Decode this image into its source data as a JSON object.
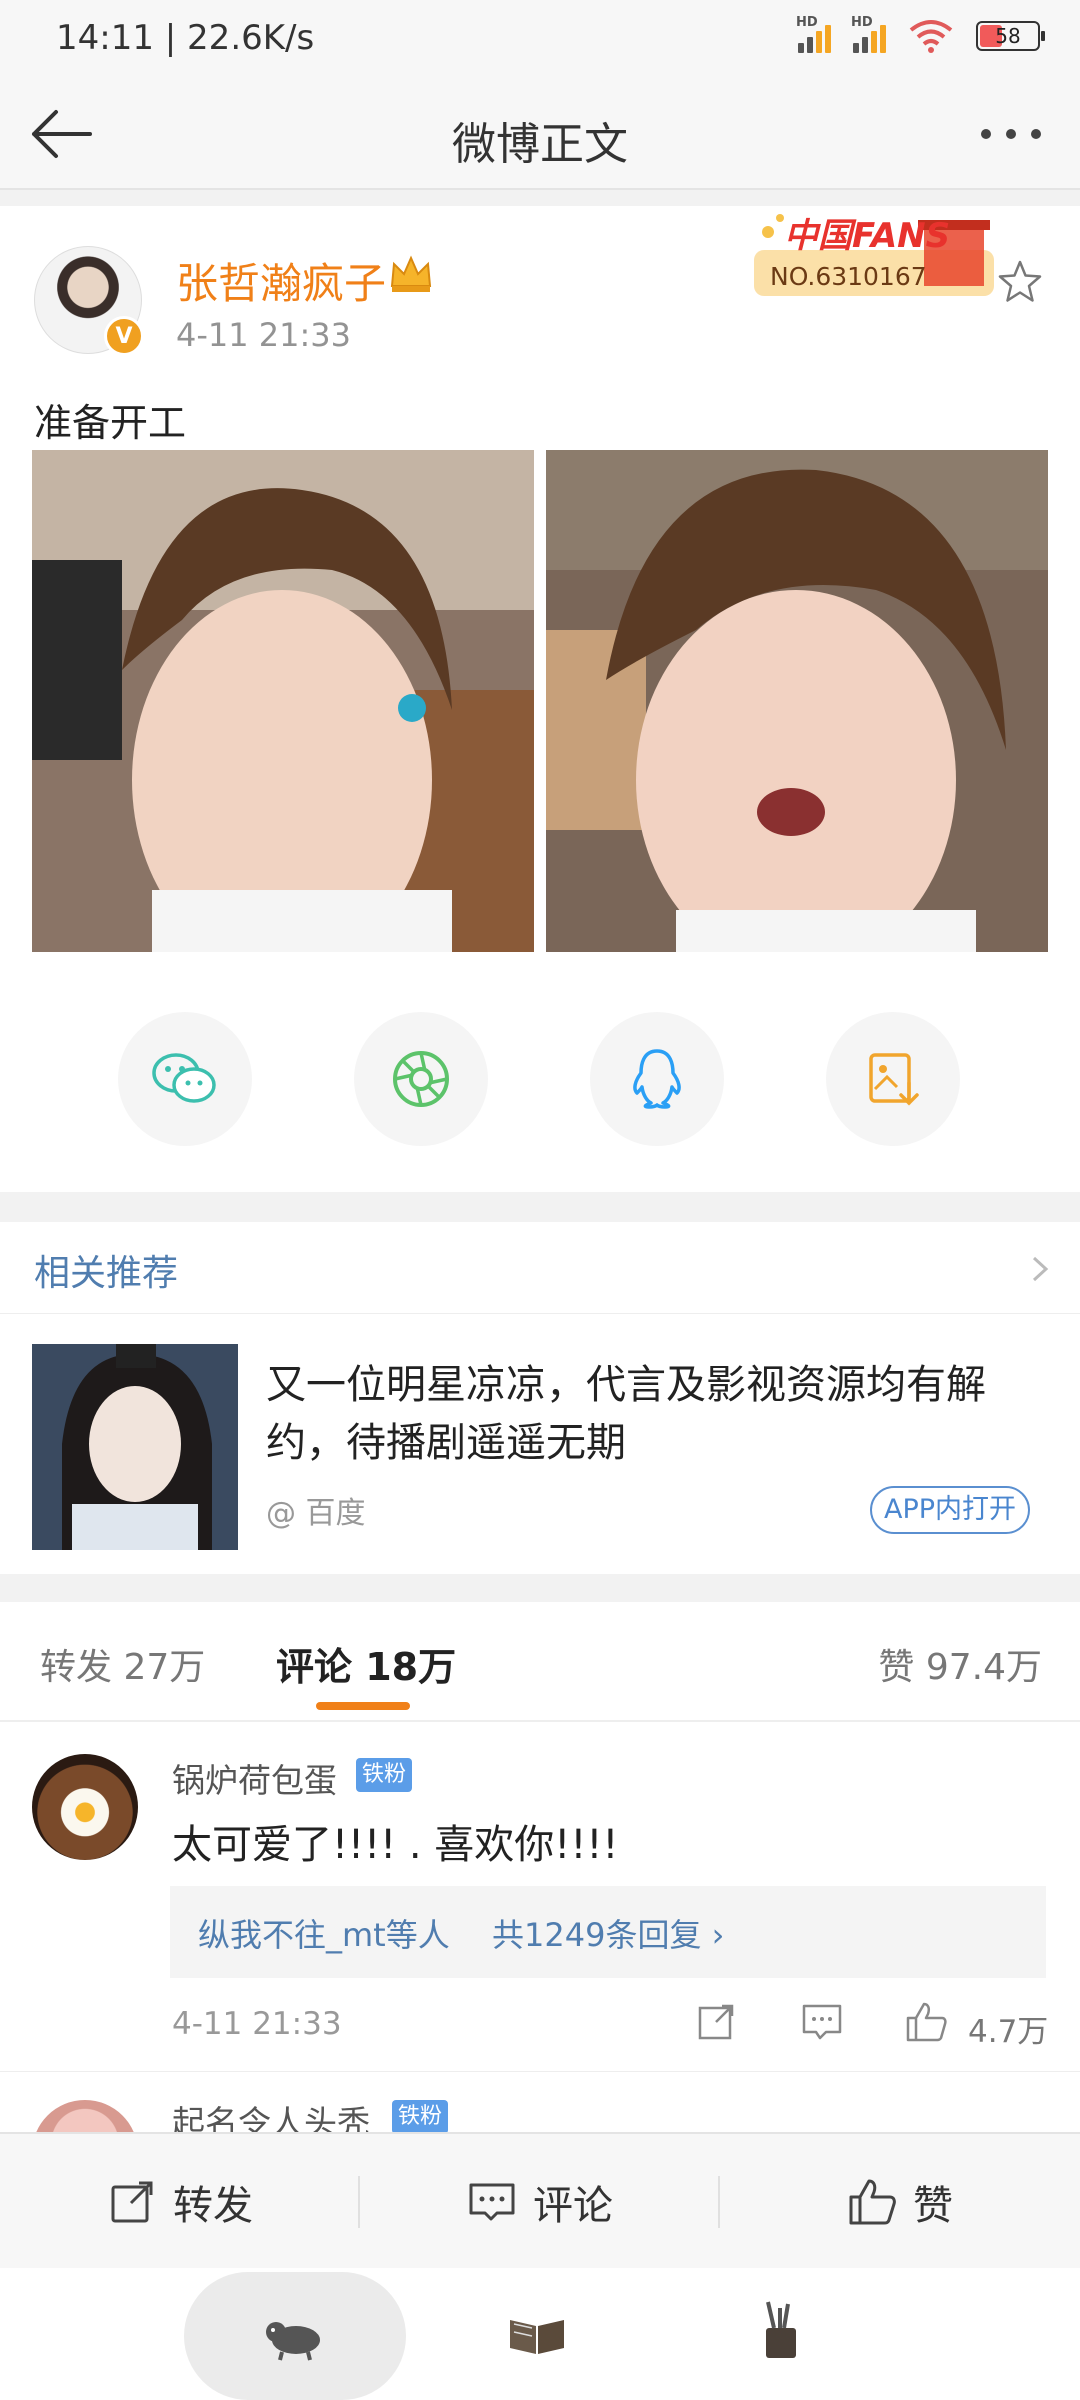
{
  "status_bar": {
    "time_speed": "14:11 | 22.6K/s",
    "signal1_label": "HD",
    "signal2_label": "HD",
    "battery": "58"
  },
  "header": {
    "title": "微博正文"
  },
  "post": {
    "username": "张哲瀚疯子",
    "time": "4-11 21:33",
    "fans_badge_title": "中国FANS",
    "fans_badge_number": "NO.6310167",
    "text": "准备开工",
    "verified_badge": "V",
    "share_icons": [
      "wechat-icon",
      "moments-icon",
      "qq-icon",
      "save-image-icon"
    ]
  },
  "related": {
    "title": "相关推荐",
    "headline": "又一位明星凉凉，代言及影视资源均有解约，待播剧遥遥无期",
    "source": "@ 百度",
    "open_button": "APP内打开"
  },
  "tabs": {
    "repost": "转发 27万",
    "comments": "评论 18万",
    "likes": "赞 97.4万"
  },
  "comments": [
    {
      "name": "锅炉荷包蛋",
      "badge": "铁粉",
      "text": "太可爱了!!!! . 喜欢你!!!!",
      "reply_names": "纵我不往_mt等人",
      "reply_count": "共1249条回复 ›",
      "time": "4-11 21:33",
      "like_count": "4.7万"
    },
    {
      "name": "起名令人头秃",
      "badge": "铁粉"
    }
  ],
  "action_bar": {
    "repost": "转发",
    "comment": "评论",
    "like": "赞"
  },
  "colors": {
    "accent_orange": "#f08018",
    "link_blue": "#507daf",
    "badge_blue": "#5b9de8"
  }
}
